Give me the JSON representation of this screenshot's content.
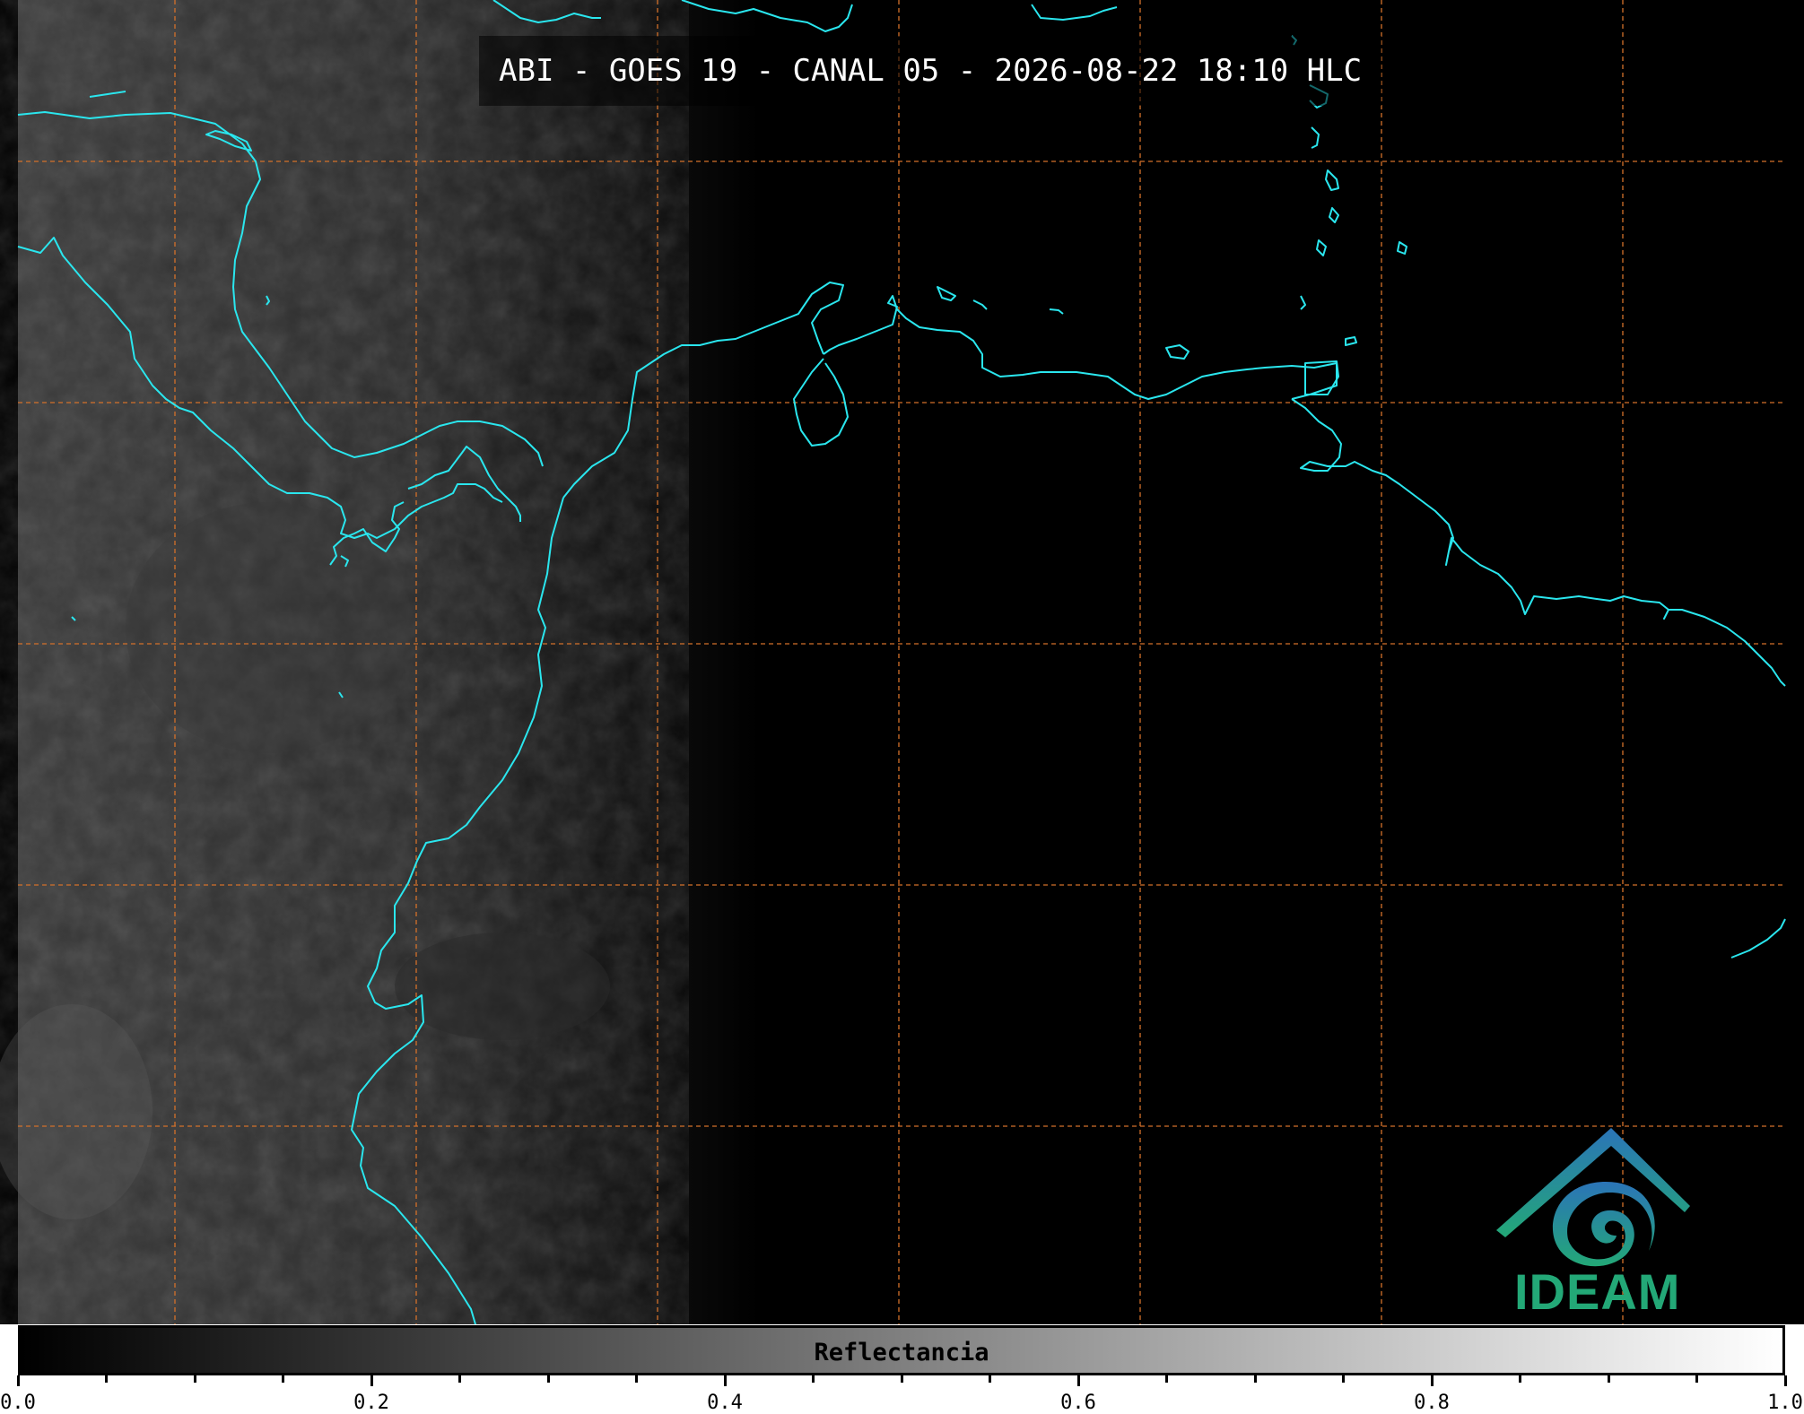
{
  "title": "ABI - GOES 19 - CANAL 05 - 2026-08-22 18:10 HLC",
  "colorbar": {
    "label": "Reflectancia",
    "min": 0.0,
    "max": 1.0,
    "tick_labels": [
      "0.0",
      "0.2",
      "0.4",
      "0.6",
      "0.8",
      "1.0"
    ],
    "colormap": [
      "#000000",
      "#ffffff"
    ]
  },
  "logo": {
    "text": "IDEAM"
  },
  "colors": {
    "coastline": "#2ae6ee",
    "grid": "#d4712a",
    "background": "#000000",
    "logo_top": "#2b74b8",
    "logo_bottom": "#23a877"
  },
  "icons": [
    "ideam-logo-icon"
  ]
}
